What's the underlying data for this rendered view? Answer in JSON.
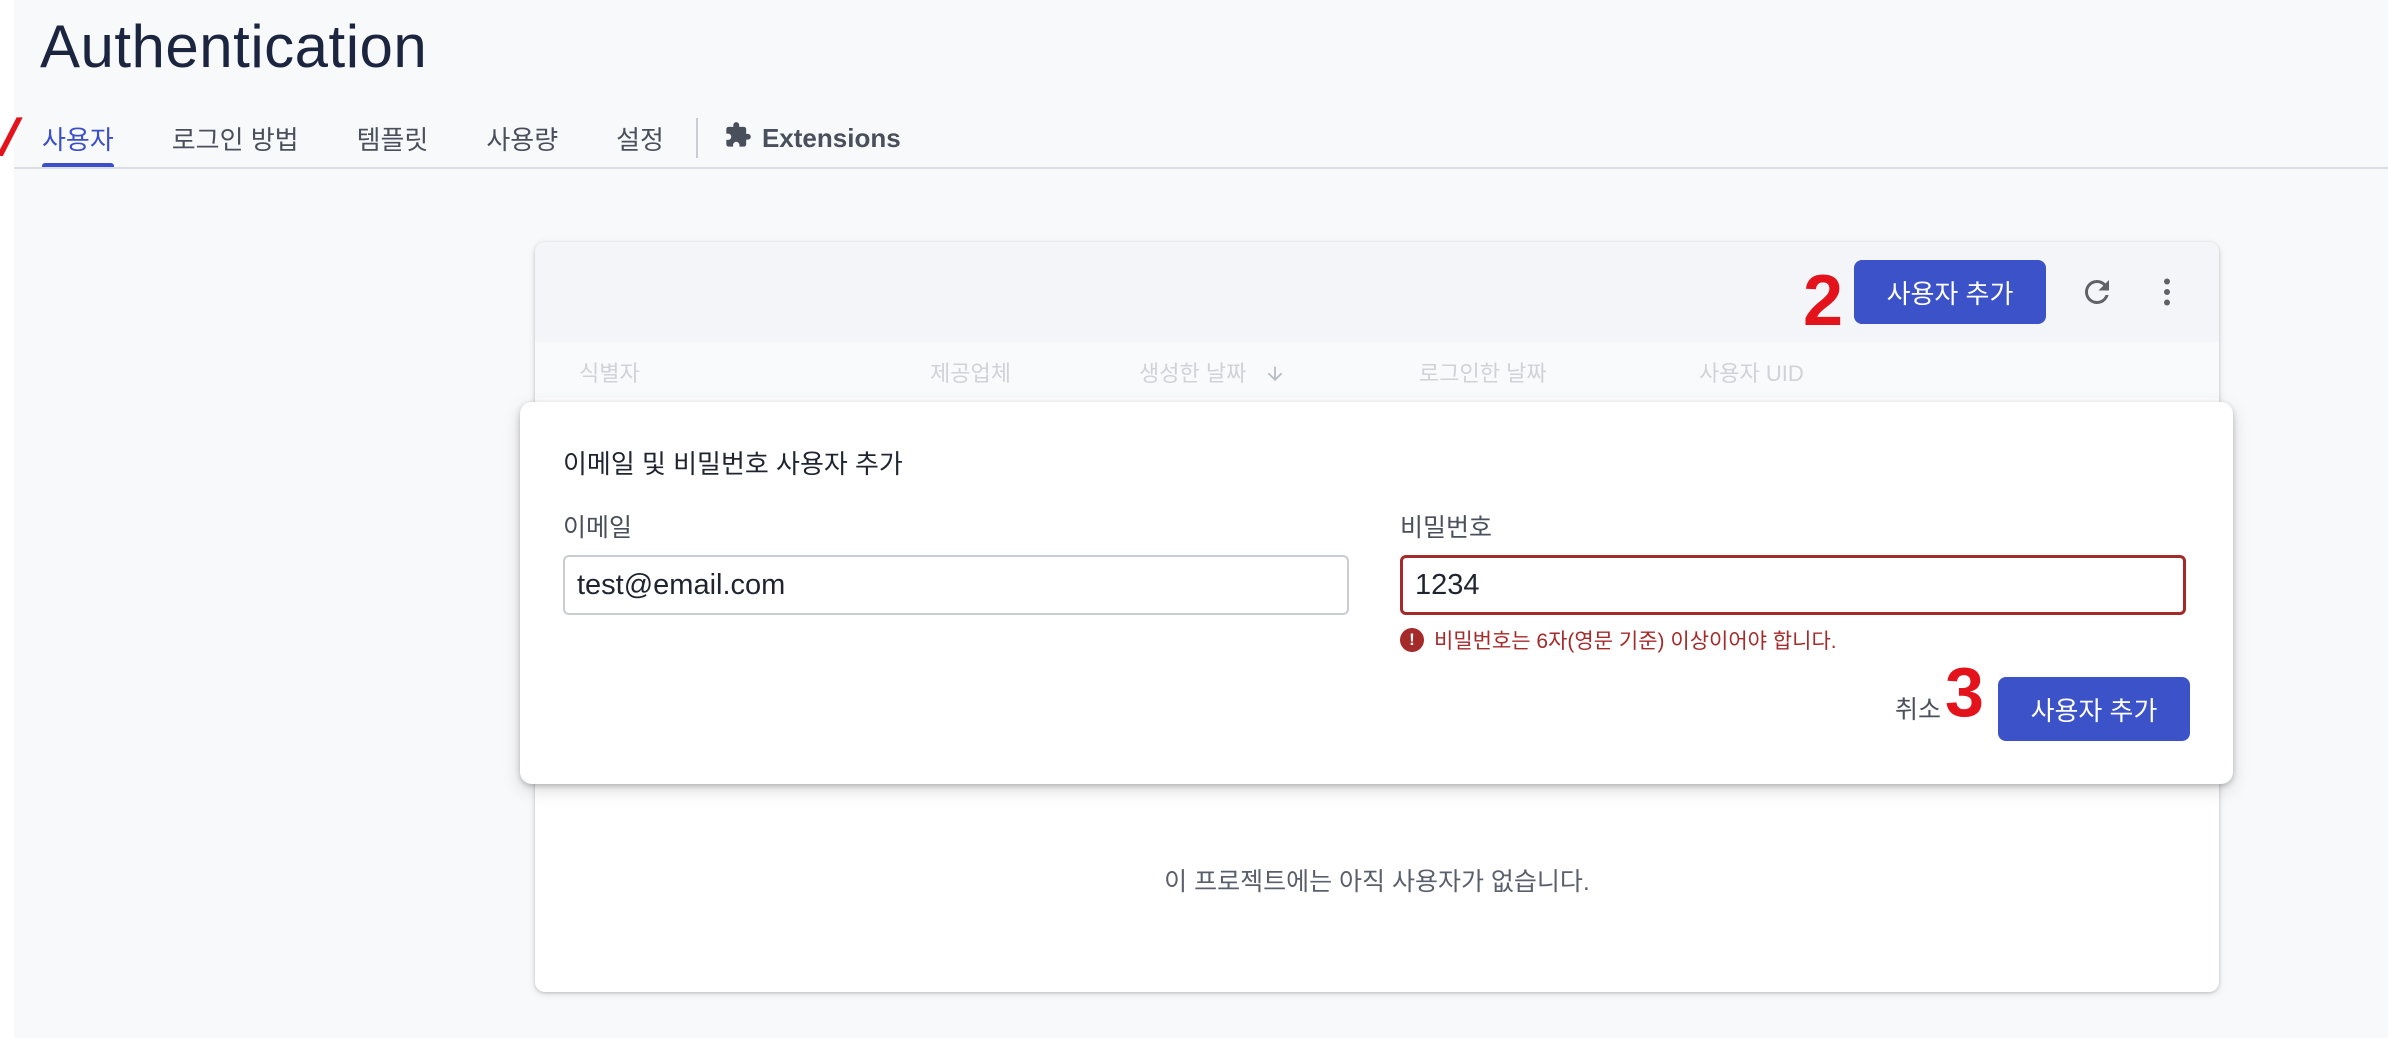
{
  "page": {
    "title": "Authentication"
  },
  "tabs": [
    {
      "label": "사용자",
      "active": true
    },
    {
      "label": "로그인 방법"
    },
    {
      "label": "템플릿"
    },
    {
      "label": "사용량"
    },
    {
      "label": "설정"
    },
    {
      "label": "Extensions",
      "icon": "puzzle-icon"
    }
  ],
  "annotations": {
    "step1": "/",
    "step2": "2",
    "step3": "3"
  },
  "users_card": {
    "add_user_label": "사용자 추가",
    "refresh_icon": "refresh-icon",
    "more_icon": "more-vert-icon",
    "columns": [
      "식별자",
      "제공업체",
      "생성한 날짜",
      "로그인한 날짜",
      "사용자 UID"
    ],
    "sort_icon": "arrow-down-icon",
    "empty_message": "이 프로젝트에는 아직 사용자가 없습니다."
  },
  "dialog": {
    "title": "이메일 및 비밀번호 사용자 추가",
    "email_label": "이메일",
    "email_value": "test@email.com",
    "password_label": "비밀번호",
    "password_value": "1234",
    "error_text": "비밀번호는 6자(영문 기준) 이상이어야 합니다.",
    "cancel_label": "취소",
    "submit_label": "사용자 추가"
  },
  "colors": {
    "accent": "#3c52c9",
    "error": "#a52a2a",
    "annotation": "#e3121b"
  }
}
